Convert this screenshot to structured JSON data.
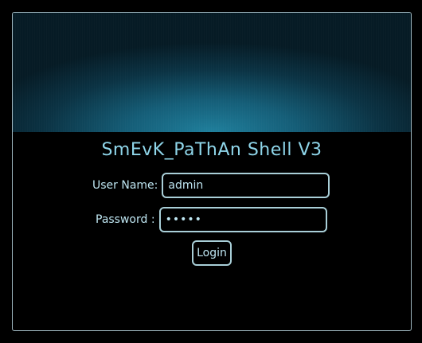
{
  "title": "SmEvK_PaThAn Shell V3",
  "form": {
    "username_label": "User Name:",
    "username_value": "admin",
    "password_label": "Password :",
    "password_display": "•••••",
    "login_label": "Login"
  }
}
